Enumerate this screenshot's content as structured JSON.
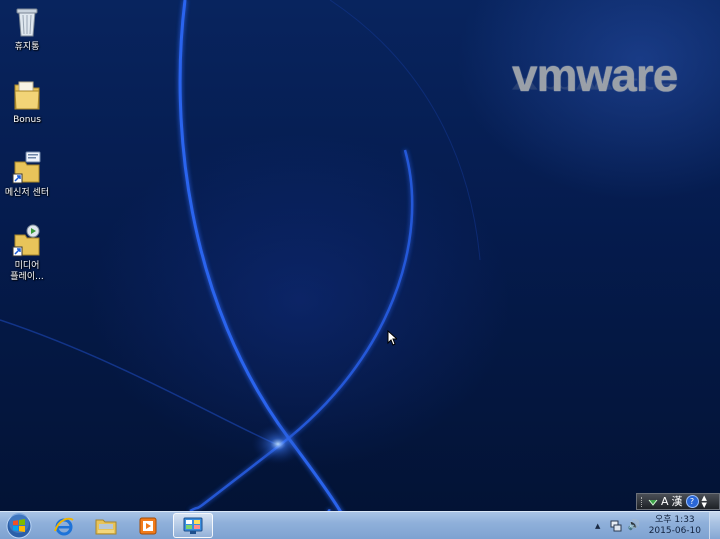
{
  "desktop": {
    "logo_text": "vmware",
    "icons": [
      {
        "label": "휴지통"
      },
      {
        "label": "Bonus"
      },
      {
        "label": "메신저 센터"
      },
      {
        "label_line1": "미디어",
        "label_line2": "플레이..."
      }
    ]
  },
  "language_bar": {
    "mode_label": "A",
    "hanja_label": "漢",
    "help_label": "?"
  },
  "taskbar": {
    "pinned": [
      "internet-explorer",
      "windows-explorer",
      "media-player",
      "messenger-center"
    ],
    "tray": {
      "overflow_glyph": "▲",
      "volume_glyph": "🔊"
    },
    "clock": {
      "time": "오후 1:33",
      "date": "2015-06-10"
    }
  },
  "colors": {
    "wallpaper": "#051b4d",
    "taskbar": "#8fb0da"
  }
}
